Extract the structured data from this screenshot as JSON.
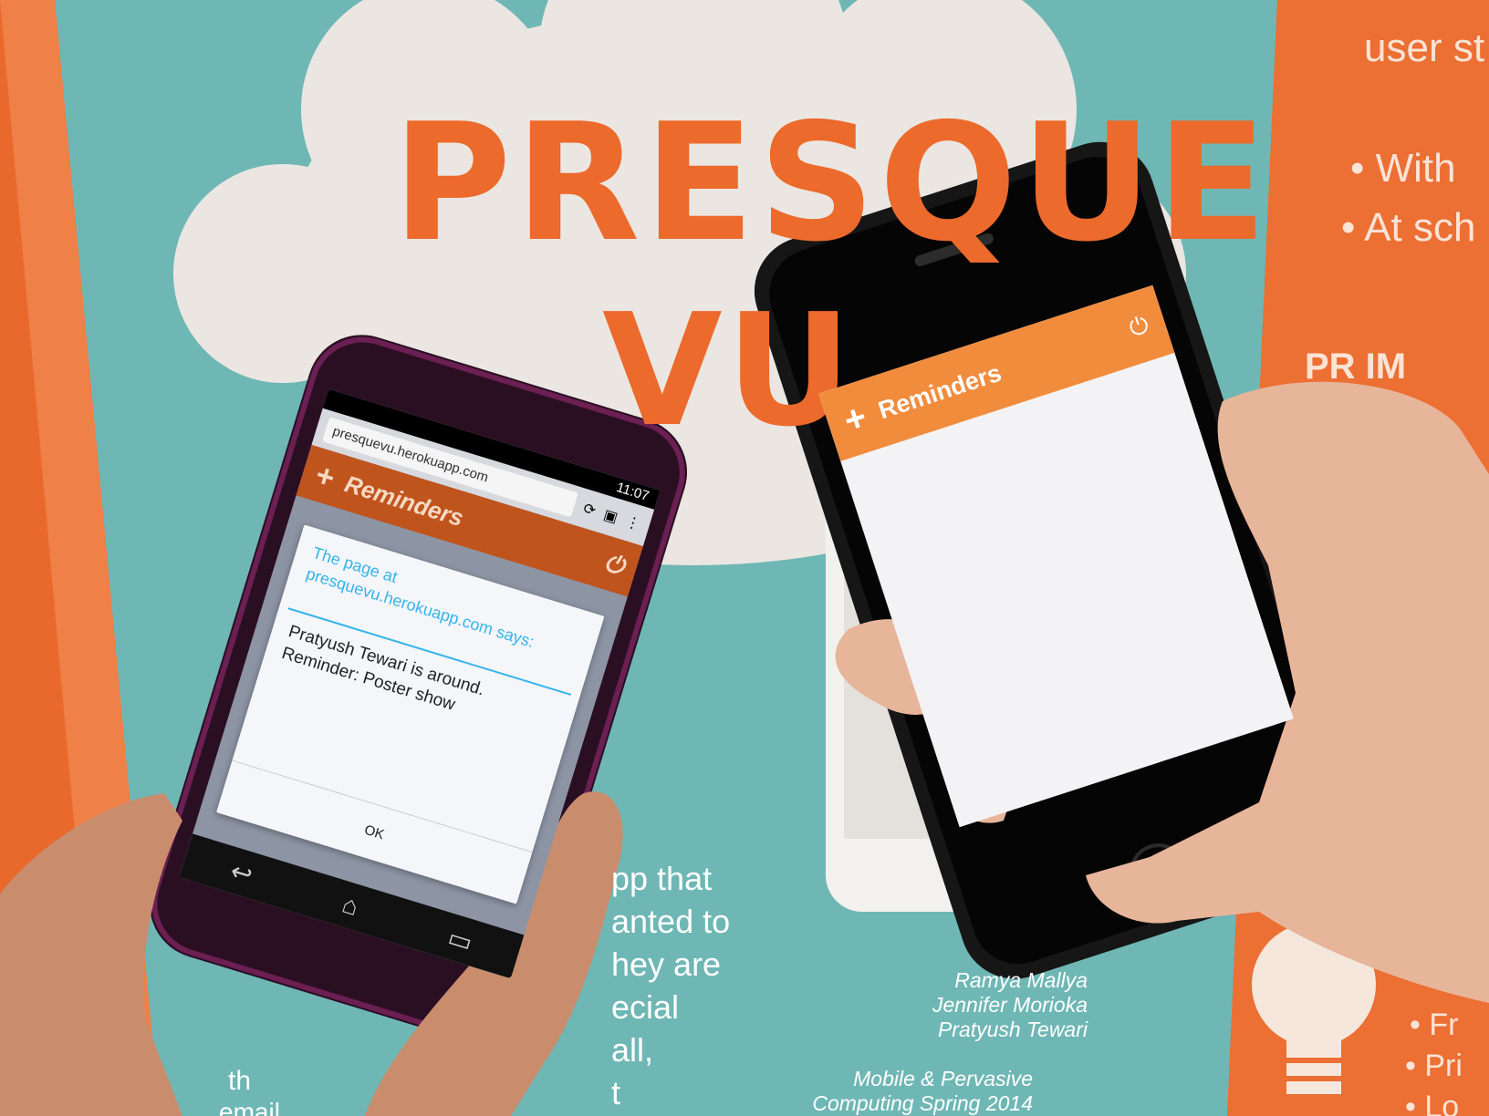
{
  "poster": {
    "title_line1": "PRESQUE",
    "title_line2": "VU",
    "right_text": [
      "user st",
      "• With",
      "• At sch",
      "PR  IM"
    ],
    "right_bottom_text": [
      "• Fr",
      "• Pri",
      "• Lo"
    ],
    "description_lines": [
      "pp that",
      "anted to",
      "hey are",
      "ecial",
      "all,",
      "t"
    ],
    "left_bottom_text": "th",
    "left_bottom_text2": "email",
    "credits": [
      "Ramya Mallya",
      "Jennifer Morioka",
      "Pratyush Tewari"
    ],
    "course": [
      "Mobile & Pervasive",
      "Computing Spring 2014"
    ]
  },
  "android": {
    "time": "11:07",
    "url": "presquevu.herokuapp.com",
    "add_icon": "+",
    "app_title": "Reminders",
    "power_icon": "⏻",
    "dialog": {
      "title": "The page at presquevu.herokuapp.com says:",
      "message_line1": "Pratyush Tewari is around.",
      "message_line2": "Reminder: Poster show",
      "ok_label": "OK"
    },
    "nav": {
      "back": "↩",
      "home": "⌂",
      "recent": "▭"
    }
  },
  "iphone": {
    "add_icon": "+",
    "app_title": "Reminders",
    "power_icon": "⏻"
  },
  "colors": {
    "poster_orange": "#ec6a2b",
    "poster_teal": "#6fb7b5",
    "cloud": "#ebe6e2",
    "app_orange": "#f28c3d",
    "dialog_blue": "#35b4ea"
  }
}
